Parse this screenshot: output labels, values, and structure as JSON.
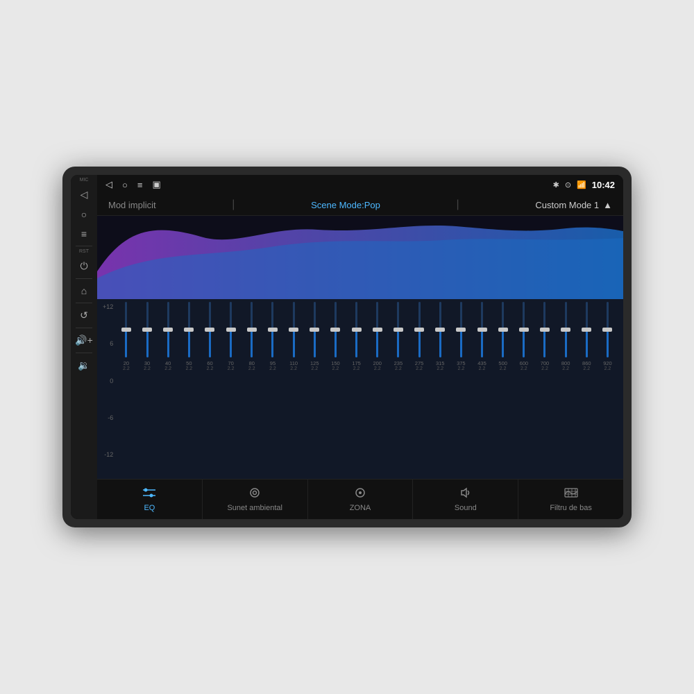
{
  "device": {
    "status_bar": {
      "mic_label": "MIC",
      "rst_label": "RST",
      "time": "10:42",
      "nav_back": "◁",
      "nav_home": "○",
      "nav_menu": "≡",
      "nav_recent": "▣",
      "icon_bluetooth": "✱",
      "icon_location": "⊙",
      "icon_wifi": "▾",
      "icon_signal": "▾"
    },
    "mode_bar": {
      "mode_implicit": "Mod implicit",
      "scene_mode": "Scene Mode:Pop",
      "custom_mode": "Custom Mode 1",
      "expand_icon": "▲"
    },
    "eq_scale": {
      "labels": [
        "+12",
        "6",
        "0",
        "-6",
        "-12"
      ]
    },
    "eq_frequencies": [
      {
        "fc": "20",
        "q": "2.2"
      },
      {
        "fc": "30",
        "q": "2.2"
      },
      {
        "fc": "40",
        "q": "2.2"
      },
      {
        "fc": "50",
        "q": "2.2"
      },
      {
        "fc": "60",
        "q": "2.2"
      },
      {
        "fc": "70",
        "q": "2.2"
      },
      {
        "fc": "80",
        "q": "2.2"
      },
      {
        "fc": "95",
        "q": "2.2"
      },
      {
        "fc": "110",
        "q": "2.2"
      },
      {
        "fc": "125",
        "q": "2.2"
      },
      {
        "fc": "150",
        "q": "2.2"
      },
      {
        "fc": "175",
        "q": "2.2"
      },
      {
        "fc": "200",
        "q": "2.2"
      },
      {
        "fc": "235",
        "q": "2.2"
      },
      {
        "fc": "275",
        "q": "2.2"
      },
      {
        "fc": "315",
        "q": "2.2"
      },
      {
        "fc": "375",
        "q": "2.2"
      },
      {
        "fc": "435",
        "q": "2.2"
      },
      {
        "fc": "500",
        "q": "2.2"
      },
      {
        "fc": "600",
        "q": "2.2"
      },
      {
        "fc": "700",
        "q": "2.2"
      },
      {
        "fc": "800",
        "q": "2.2"
      },
      {
        "fc": "860",
        "q": "2.2"
      },
      {
        "fc": "920",
        "q": "2.2"
      }
    ],
    "eq_slider_positions": [
      0.5,
      0.5,
      0.5,
      0.5,
      0.5,
      0.5,
      0.5,
      0.5,
      0.5,
      0.5,
      0.5,
      0.5,
      0.5,
      0.5,
      0.5,
      0.5,
      0.5,
      0.5,
      0.5,
      0.5,
      0.5,
      0.5,
      0.5,
      0.5
    ],
    "bottom_nav": [
      {
        "id": "eq",
        "icon": "⚙",
        "label": "EQ",
        "active": true
      },
      {
        "id": "sunet",
        "icon": "◎",
        "label": "Sunet ambiental",
        "active": false
      },
      {
        "id": "zona",
        "icon": "◎",
        "label": "ZONA",
        "active": false
      },
      {
        "id": "sound",
        "icon": "◇",
        "label": "Sound",
        "active": false
      },
      {
        "id": "filtru",
        "icon": "▦",
        "label": "Filtru de bas",
        "active": false
      }
    ]
  }
}
